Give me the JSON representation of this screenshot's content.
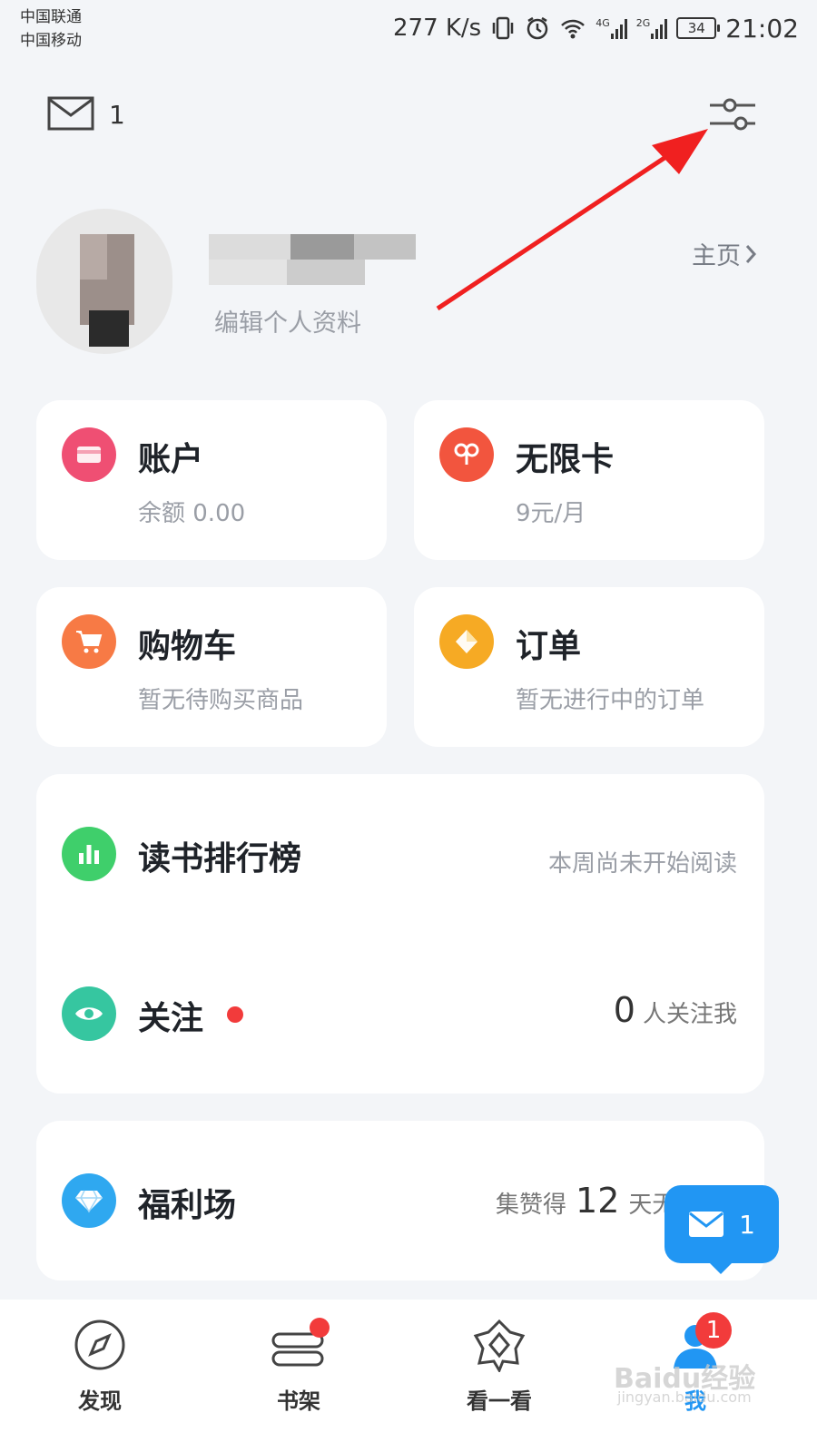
{
  "status_bar": {
    "carrier_1": "中国联通",
    "carrier_2": "中国移动",
    "speed": "277 K/s",
    "net_1": "4G",
    "net_2": "2G",
    "battery": "34",
    "time": "21:02"
  },
  "top_bar": {
    "mail_count": "1",
    "mail_icon": "mail-icon",
    "settings_icon": "settings-sliders-icon"
  },
  "profile": {
    "edit_label": "编辑个人资料",
    "homepage_label": "主页"
  },
  "cards": {
    "account": {
      "title": "账户",
      "subtitle": "余额 0.00",
      "color": "#ef4f73"
    },
    "unlimited": {
      "title": "无限卡",
      "subtitle": "9元/月",
      "color": "#f2553e"
    },
    "cart": {
      "title": "购物车",
      "subtitle": "暂无待购买商品",
      "color": "#f77a45"
    },
    "orders": {
      "title": "订单",
      "subtitle": "暂无进行中的订单",
      "color": "#f6aa24"
    }
  },
  "list_card": {
    "ranking": {
      "title": "读书排行榜",
      "status": "本周尚未开始阅读",
      "color": "#3fcf6b"
    },
    "follow": {
      "title": "关注",
      "count": "0",
      "status": "人关注我",
      "color": "#36c6a0"
    }
  },
  "welfare": {
    "title": "福利场",
    "status_prefix": "集赞得",
    "status_number": "12",
    "status_suffix": "天无",
    "color": "#2fa8f0"
  },
  "floating_mail": {
    "count": "1",
    "color": "#2196f3"
  },
  "bottom_nav": {
    "discover": "发现",
    "bookshelf": "书架",
    "look": "看一看",
    "me": "我",
    "me_badge": "1"
  },
  "watermark": {
    "text": "Baidu经验",
    "sub": "jingyan.baidu.com"
  }
}
